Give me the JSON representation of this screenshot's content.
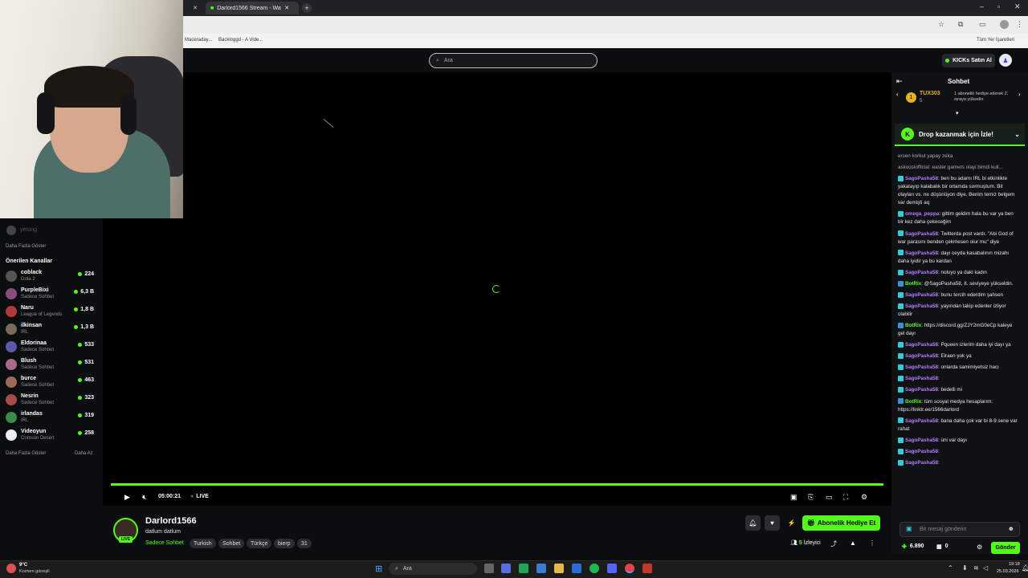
{
  "browser": {
    "tabs": [
      {
        "label": ""
      },
      {
        "label": "Darlord1566 Stream - Watch Li..."
      }
    ],
    "bookmarks": [
      "Maceraday...",
      "Backloggd - A Vide...",
      "Tüm Yer İşaretleri"
    ]
  },
  "header": {
    "search_placeholder": "Ara",
    "kicks_button": "KICKs Satın Al"
  },
  "sidebar": {
    "followed_channel": "yetung",
    "show_more_top": "Daha Fazla Göster",
    "recommended_heading": "Önerilen Kanallar",
    "channels": [
      {
        "name": "coblack",
        "category": "Dota 2",
        "viewers": "224",
        "color": "#555"
      },
      {
        "name": "PurpleBixi",
        "category": "Sadece Sohbet",
        "viewers": "6,3 B",
        "color": "#8a4d7a"
      },
      {
        "name": "Naru",
        "category": "League of Legends",
        "viewers": "1,8 B",
        "color": "#b03a3a"
      },
      {
        "name": "ilkinsan",
        "category": "IRL",
        "viewers": "1,3 B",
        "color": "#7a6a5a"
      },
      {
        "name": "Eldorinaa",
        "category": "Sadece Sohbet",
        "viewers": "533",
        "color": "#5a5aa8"
      },
      {
        "name": "Blush",
        "category": "Sadece Sohbet",
        "viewers": "531",
        "color": "#a86a8a"
      },
      {
        "name": "burce",
        "category": "Sadece Sohbet",
        "viewers": "463",
        "color": "#9a6a5a"
      },
      {
        "name": "Nesrin",
        "category": "Sadece Sohbet",
        "viewers": "323",
        "color": "#a84a4a"
      },
      {
        "name": "irlandas",
        "category": "IRL",
        "viewers": "319",
        "color": "#3a8a4a"
      },
      {
        "name": "Videoyun",
        "category": "Crimson Desert",
        "viewers": "258",
        "color": "#eeeeee"
      }
    ],
    "show_more": "Daha Fazla Göster",
    "show_less": "Daha Az"
  },
  "player": {
    "time": "05:00:21",
    "live_label": "LIVE",
    "progress": 1.0
  },
  "stream": {
    "streamer": "Darlord1566",
    "title": "datlum datlum",
    "live_badge": "LIVE",
    "category": "Sadece Sohbet",
    "tags": [
      "Turkish",
      "Sohbet",
      "Türkçe",
      "bierp",
      "31"
    ],
    "gift_button": "Abonelik Hediye Et",
    "viewers_count": "5",
    "viewers_label": "İzleyici"
  },
  "chat": {
    "title": "Sohbet",
    "top_gifter_name": "TUX303",
    "top_gifter_count": "5",
    "gift_prompt": "1 abonelik hediye ederek 2. sıraya yükselin",
    "drop_banner": "Drop kazanmak için İzle!",
    "messages": [
      {
        "user": "",
        "text": "ersen korkut yapay zeka",
        "color": "#aaaaaa"
      },
      {
        "user": "",
        "text": "askoosiofficial: easter gamers olayi bimdi kull...",
        "color": "#aaaaaa"
      },
      {
        "user": "SagoPasha58",
        "text": ": ben bu adamı IRL bi etkinlikte yakalayıp kalabalık bir ortamda sormuştum. Bit olayları vs. ne düşünüyon diye. Benim temiz belgem var demişti aq",
        "color": "#b97aff"
      },
      {
        "user": "omega_peppa",
        "text": ": gittim geldim hala bu var ya ben bir kez daha çekeceğim",
        "color": "#b97aff"
      },
      {
        "user": "SagoPasha58",
        "text": ": Twitterda post vardı. \"Abi God of war parasını benden çekmesen olur mu\" diye",
        "color": "#b97aff"
      },
      {
        "user": "SagoPasha58",
        "text": ": dayı ceyda kasabalının mizahı daha iyidir ya bu kardan",
        "color": "#b97aff"
      },
      {
        "user": "SagoPasha58",
        "text": ": noluyo ya daki kadın",
        "color": "#b97aff"
      },
      {
        "user": "BotRix",
        "text": ": @SagoPasha58, 8. seviyeye yükseldin.",
        "color": "#53fc18",
        "bot": true
      },
      {
        "user": "SagoPasha58",
        "text": ": bunu tercih ederdim şahsen",
        "color": "#b97aff"
      },
      {
        "user": "SagoPasha58",
        "text": ": yayından takip edenler izliyor olabilir",
        "color": "#b97aff"
      },
      {
        "user": "BotRix",
        "text": ": https://discord.gg/ZJY2mG0eCp kaleye gel dayı",
        "color": "#53fc18",
        "bot": true
      },
      {
        "user": "SagoPasha58",
        "text": ": Pqueen izlerim daha iyi dayı ya",
        "color": "#b97aff"
      },
      {
        "user": "SagoPasha58",
        "text": ": Elraen yok ya",
        "color": "#b97aff"
      },
      {
        "user": "SagoPasha58",
        "text": ": onlarda samimiyetsiz hacı",
        "color": "#b97aff"
      },
      {
        "user": "SagoPasha58",
        "text": ":",
        "color": "#b97aff"
      },
      {
        "user": "SagoPasha58",
        "text": ": bedelli mi",
        "color": "#b97aff"
      },
      {
        "user": "BotRix",
        "text": ": tüm sosyal medya hesaplarım: https://linktr.ee/1566darlord",
        "color": "#53fc18",
        "bot": true
      },
      {
        "user": "SagoPasha58",
        "text": ": bana daha çok var bi 8-9 sene var rahat",
        "color": "#b97aff"
      },
      {
        "user": "SagoPasha58",
        "text": ": üni var dayı",
        "color": "#b97aff"
      },
      {
        "user": "SagoPasha58",
        "text": ":",
        "color": "#b97aff"
      },
      {
        "user": "SagoPasha58",
        "text": ":",
        "color": "#b97aff"
      }
    ],
    "input_placeholder": "Bir mesaj gönderin",
    "points": "6.890",
    "subs": "0",
    "send_button": "Gönder"
  },
  "taskbar": {
    "weather_temp": "9°C",
    "weather_desc": "Kısmen güneşli",
    "search_placeholder": "Ara",
    "time": "19:18",
    "date": "25.03.2026"
  }
}
